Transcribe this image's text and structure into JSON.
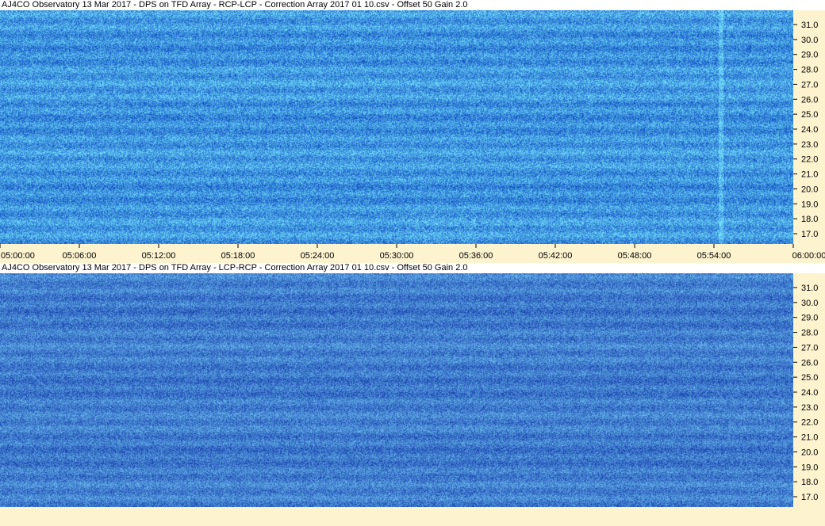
{
  "panels": [
    {
      "title": "AJ4CO Observatory 13 Mar 2017  -  DPS on TFD Array  -  RCP-LCP  -  Correction Array 2017 01 10.csv  -  Offset 50  Gain 2.0",
      "mode": "bright",
      "time_labels": [
        "05:00:00",
        "05:06:00",
        "05:12:00",
        "05:18:00",
        "05:24:00",
        "05:30:00",
        "05:36:00",
        "05:42:00",
        "05:48:00",
        "05:54:00",
        "06:00:00"
      ]
    },
    {
      "title": "AJ4CO Observatory 13 Mar 2017  -  DPS on TFD Array  -  LCP-RCP  -  Correction Array 2017 01 10.csv  -  Offset 50  Gain 2.0",
      "mode": "dark",
      "time_labels": []
    }
  ],
  "freq_labels": [
    "31.0",
    "30.0",
    "29.0",
    "28.0",
    "27.0",
    "26.0",
    "25.0",
    "24.0",
    "23.0",
    "22.0",
    "21.0",
    "20.0",
    "19.0",
    "18.0",
    "17.0"
  ],
  "colors": {
    "background": "#fdf3cf",
    "spectro_base": "#1f5fe0",
    "burst_bright": "#9ff0c8",
    "burst_dark": "#08205a"
  }
}
